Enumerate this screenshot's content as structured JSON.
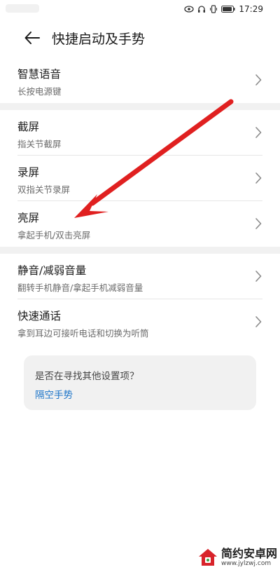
{
  "status_bar": {
    "time": "17:29"
  },
  "header": {
    "title": "快捷启动及手势"
  },
  "sections": [
    {
      "items": [
        {
          "title": "智慧语音",
          "subtitle": "长按电源键"
        }
      ]
    },
    {
      "items": [
        {
          "title": "截屏",
          "subtitle": "指关节截屏"
        },
        {
          "title": "录屏",
          "subtitle": "双指关节录屏"
        },
        {
          "title": "亮屏",
          "subtitle": "拿起手机/双击亮屏"
        }
      ]
    },
    {
      "items": [
        {
          "title": "静音/减弱音量",
          "subtitle": "翻转手机静音/拿起手机减弱音量"
        },
        {
          "title": "快速通话",
          "subtitle": "拿到耳边可接听电话和切换为听筒"
        }
      ]
    }
  ],
  "suggestion": {
    "question": "是否在寻找其他设置项？",
    "link": "隔空手势"
  },
  "annotation": {
    "color": "#e02020"
  },
  "watermark": {
    "name": "简约安卓网",
    "url": "www.jylzwj.com"
  },
  "colors": {
    "accent": "#1a73c8",
    "divider": "#e6e6e6",
    "section_gap": "#f1f1f1"
  }
}
